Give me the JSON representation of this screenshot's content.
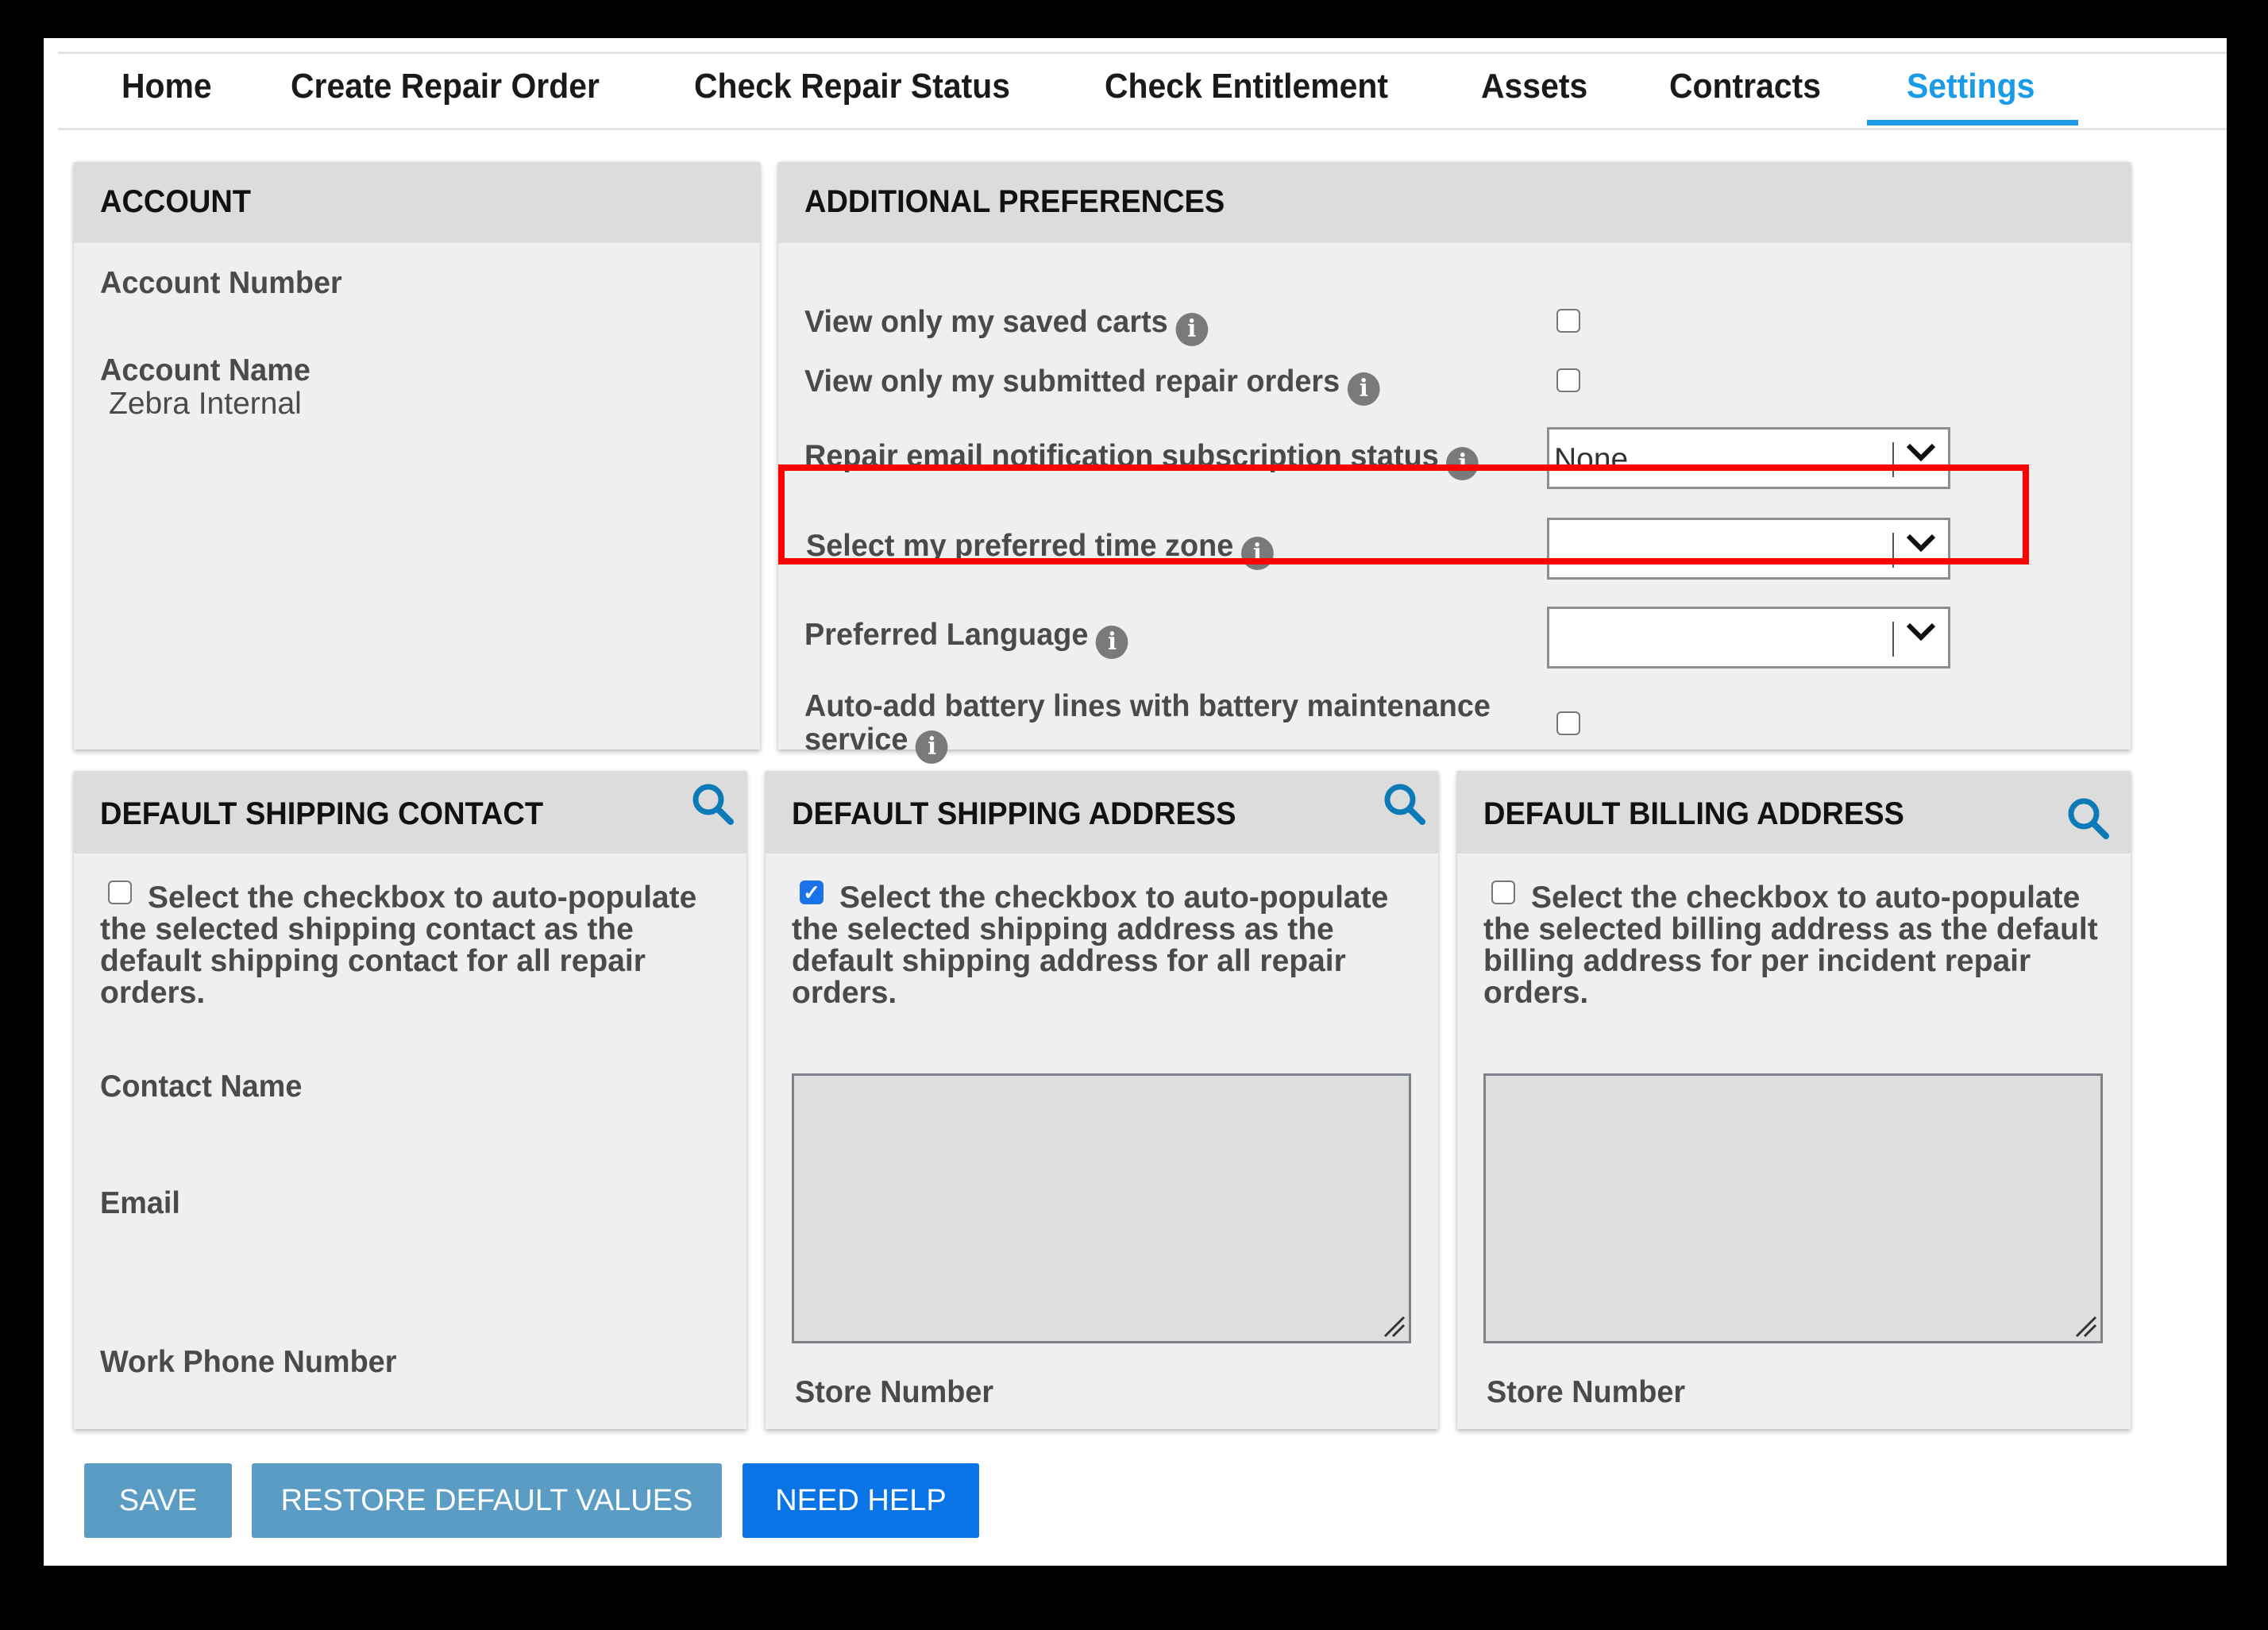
{
  "nav": {
    "tabs": [
      {
        "label": "Home",
        "active": false
      },
      {
        "label": "Create Repair Order",
        "active": false
      },
      {
        "label": "Check Repair Status",
        "active": false
      },
      {
        "label": "Check Entitlement",
        "active": false
      },
      {
        "label": "Assets",
        "active": false
      },
      {
        "label": "Contracts",
        "active": false
      },
      {
        "label": "Settings",
        "active": true
      }
    ],
    "active_color": "#1a9be8"
  },
  "account": {
    "title": "ACCOUNT",
    "account_number_label": "Account Number",
    "account_number_value": "",
    "account_name_label": "Account Name",
    "account_name_value": "Zebra Internal"
  },
  "preferences": {
    "title": "ADDITIONAL PREFERENCES",
    "saved_carts": {
      "label": "View only my saved carts",
      "checked": false
    },
    "submitted_orders": {
      "label": "View only my submitted repair orders",
      "checked": false
    },
    "email_notification": {
      "label": "Repair email notification subscription status",
      "value": "None"
    },
    "time_zone": {
      "label": "Select my preferred time zone",
      "value": "",
      "highlighted": true
    },
    "language": {
      "label": "Preferred Language",
      "value": ""
    },
    "battery": {
      "label_line1": "Auto-add battery lines with battery maintenance",
      "label_line2": "service",
      "checked": false
    }
  },
  "shipping_contact": {
    "title": "DEFAULT SHIPPING CONTACT",
    "checkbox_checked": false,
    "description": "Select the checkbox to auto-populate the selected shipping contact as the default shipping contact for all repair orders.",
    "contact_name_label": "Contact Name",
    "email_label": "Email",
    "work_phone_label": "Work Phone Number"
  },
  "shipping_address": {
    "title": "DEFAULT SHIPPING ADDRESS",
    "checkbox_checked": true,
    "description": "Select the checkbox to auto-populate the selected shipping address as the default shipping address for all repair orders.",
    "address_value": "",
    "store_number_label": "Store Number"
  },
  "billing_address": {
    "title": "DEFAULT BILLING ADDRESS",
    "checkbox_checked": false,
    "description": "Select the checkbox to auto-populate the selected billing address as the default billing address for per incident repair orders.",
    "address_value": "",
    "store_number_label": "Store Number"
  },
  "buttons": {
    "save": "SAVE",
    "restore": "RESTORE DEFAULT VALUES",
    "help": "NEED HELP"
  },
  "colors": {
    "button_muted": "#5b9cc5",
    "button_primary": "#0a74e6",
    "search_icon": "#0d7ab8",
    "highlight": "#ff0000"
  },
  "icons": {
    "info": "info-circle-icon",
    "search": "search-icon",
    "dropdown": "chevron-down-icon",
    "checkmark": "✓"
  }
}
